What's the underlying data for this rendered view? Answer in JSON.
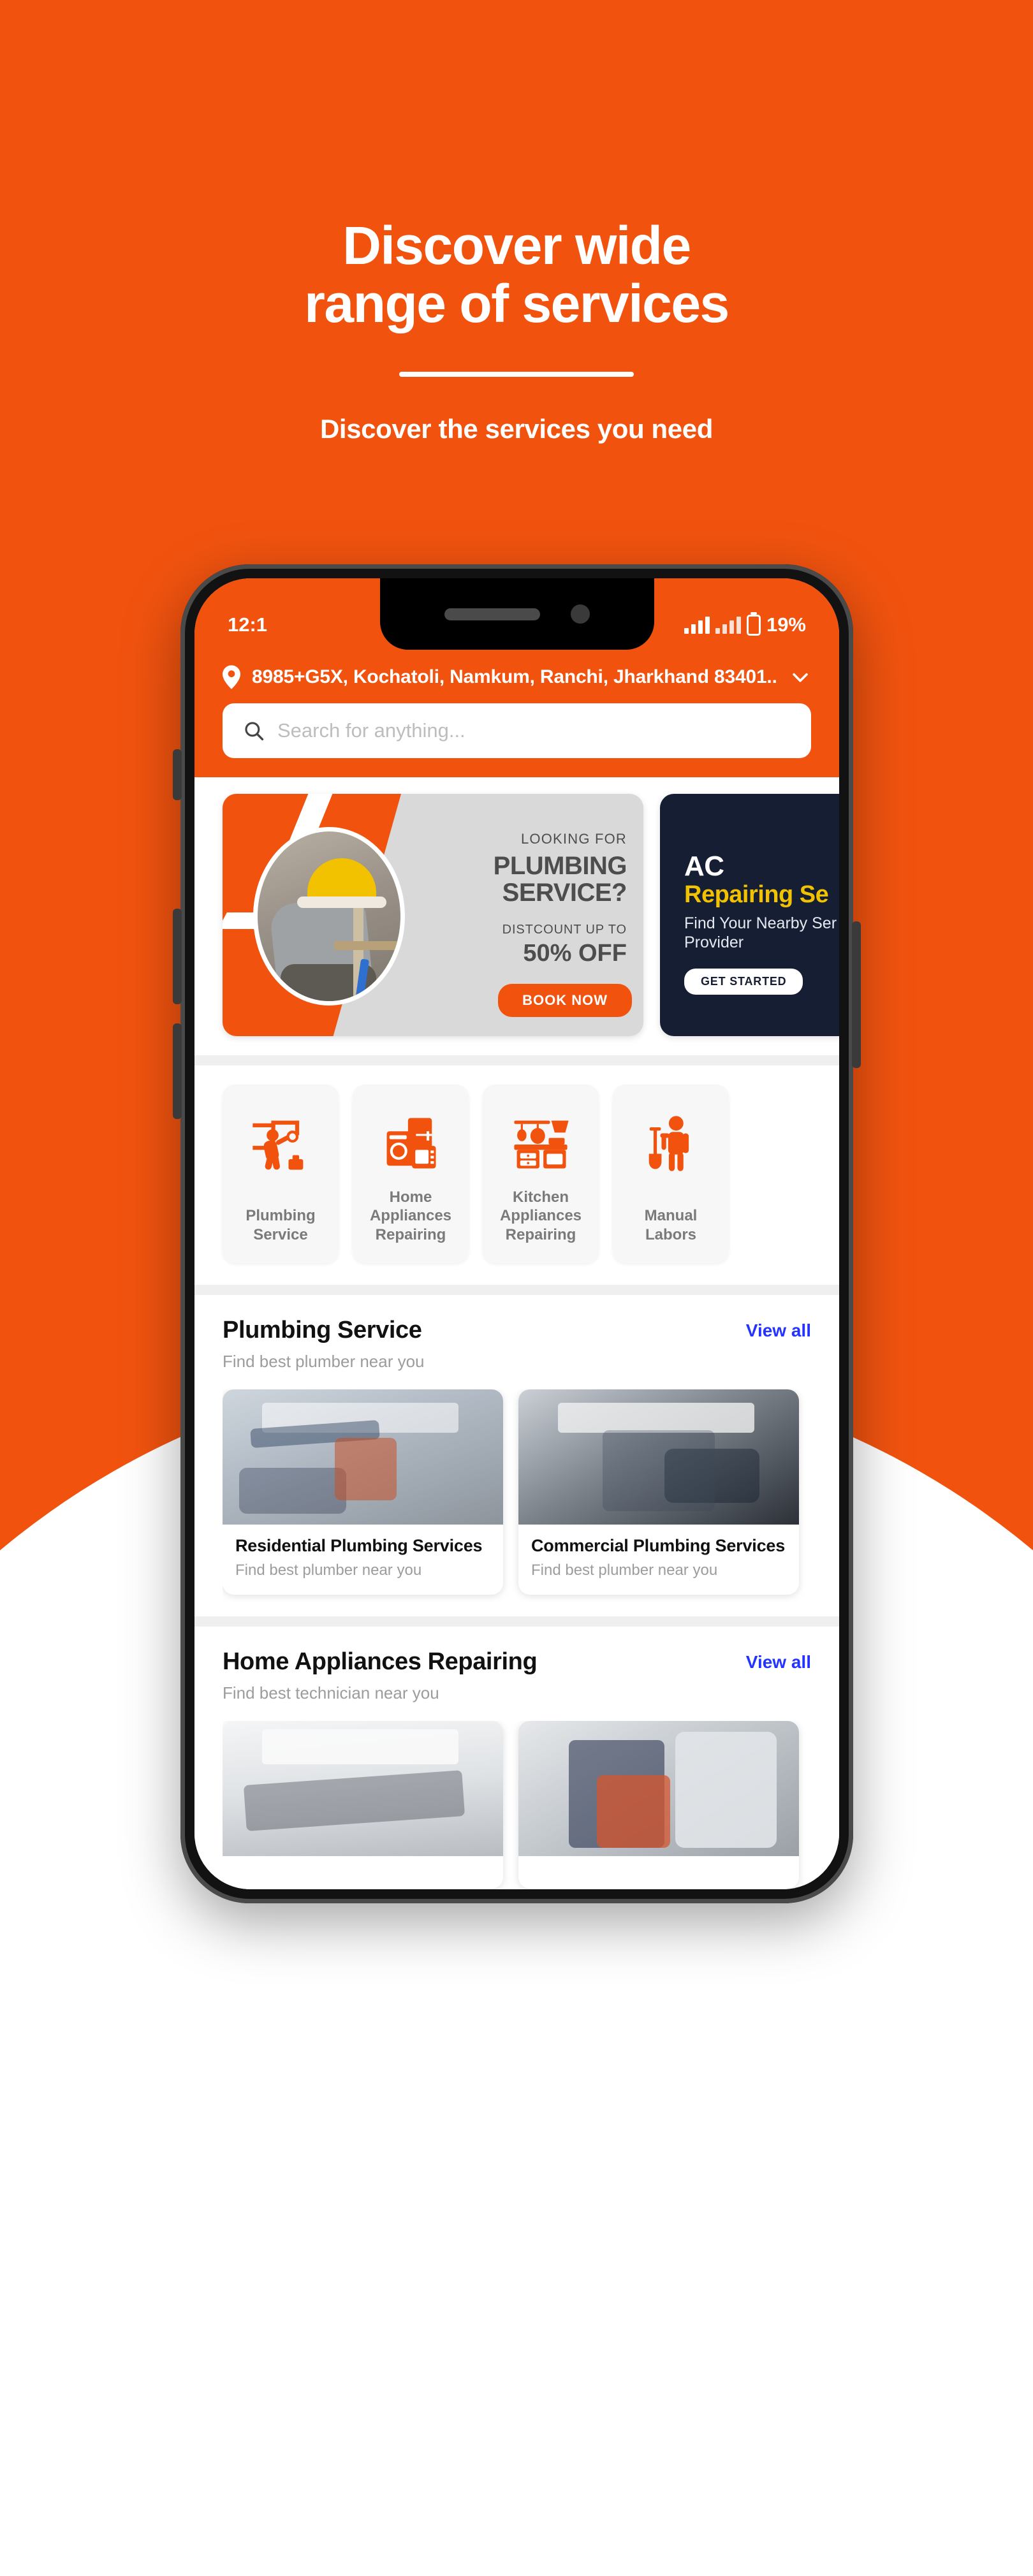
{
  "theme": {
    "orange": "#F1530F",
    "navy": "#151E33",
    "yellow": "#F2C200",
    "link_blue": "#2433FF"
  },
  "hero": {
    "title_line1": "Discover wide",
    "title_line2": "range of services",
    "subtitle": "Discover the services you need"
  },
  "phone": {
    "status_bar": {
      "time": "12:1",
      "battery_percent": "19%"
    },
    "header": {
      "location_icon": "location-pin-icon",
      "address": "8985+G5X, Kochatoli, Namkum, Ranchi, Jharkhand 83401...",
      "chevron_icon": "chevron-down-icon",
      "search_icon": "search-icon",
      "search_placeholder": "Search for anything...",
      "search_value": ""
    },
    "banners": [
      {
        "kicker": "LOOKING FOR",
        "title_line1": "PLUMBING",
        "title_line2": "SERVICE?",
        "discount_label": "DISTCOUNT UP TO",
        "discount_value": "50% OFF",
        "cta": "BOOK NOW"
      },
      {
        "title_white": "AC",
        "title_yellow": "Repairing Se",
        "subtitle": "Find Your Nearby Ser\nProvider",
        "cta": "GET STARTED"
      }
    ],
    "categories": [
      {
        "label": "Plumbing\nService",
        "icon": "plumber-worker-icon"
      },
      {
        "label": "Home\nAppliances\nRepairing",
        "icon": "home-appliances-icon"
      },
      {
        "label": "Kitchen\nAppliances\nRepairing",
        "icon": "kitchen-appliances-icon"
      },
      {
        "label": "Manual Labors",
        "icon": "manual-labor-shovel-icon"
      }
    ],
    "sections": [
      {
        "title": "Plumbing Service",
        "subtitle": "Find best plumber near you",
        "view_all": "View all",
        "cards": [
          {
            "title": "Residential Plumbing Services",
            "subtitle": "Find best plumber near you",
            "image": "plumber-working-under-sink"
          },
          {
            "title": "Commercial Plumbing Services",
            "subtitle": "Find best plumber near you",
            "image": "technician-repairing-pipes"
          }
        ]
      },
      {
        "title": "Home Appliances Repairing",
        "subtitle": "Find best technician near you",
        "view_all": "View all",
        "cards": [
          {
            "title": "",
            "subtitle": "",
            "image": "ac-unit-cleaning"
          },
          {
            "title": "",
            "subtitle": "",
            "image": "refrigerator-repair"
          }
        ]
      }
    ]
  }
}
